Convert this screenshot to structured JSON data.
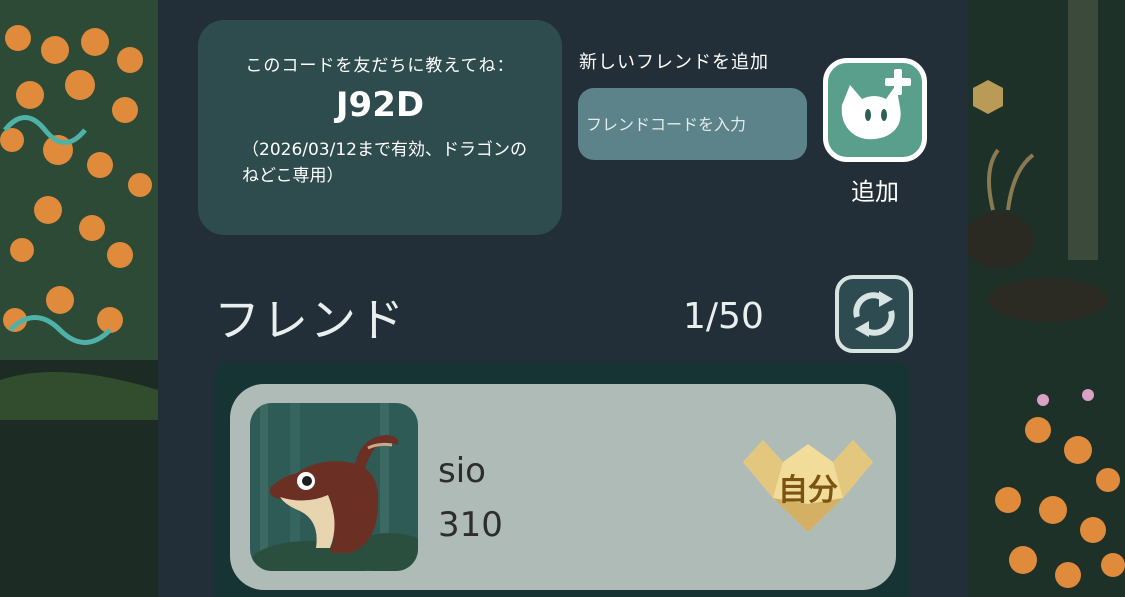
{
  "friend_code_card": {
    "caption": "このコードを友だちに教えてね：",
    "code": "J92D",
    "validity": "（2026/03/12まで有効、ドラゴンのねどこ専用）"
  },
  "add_friend": {
    "title": "新しいフレンドを追加",
    "input_placeholder": "フレンドコードを入力",
    "input_value": "",
    "button_label": "追加",
    "button_icon": "cat-plus-icon"
  },
  "friends": {
    "title": "フレンド",
    "count": "1/50",
    "refresh_icon": "refresh-icon",
    "list": [
      {
        "name": "sio",
        "score": "310",
        "badge": "自分",
        "avatar_icon": "dragon-avatar-icon"
      }
    ]
  },
  "colors": {
    "panel": "#232f38",
    "code_card": "#2e4b4d",
    "input": "#5c828a",
    "add_button": "#5a9f8b",
    "friend_card": "#aebbb6",
    "badge_gold": "#e4c77f"
  }
}
